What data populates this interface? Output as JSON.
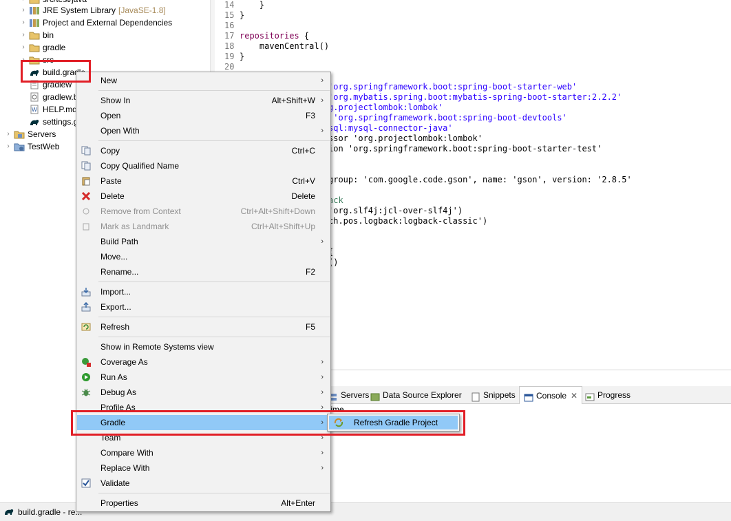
{
  "explorer": {
    "items": [
      {
        "label": "src/test/java",
        "icon": "package-folder-icon",
        "arrow": "›"
      },
      {
        "label": "JRE System Library",
        "decoration": "[JavaSE-1.8]",
        "icon": "library-icon",
        "arrow": "›"
      },
      {
        "label": "Project and External Dependencies",
        "icon": "library-icon",
        "arrow": "›"
      },
      {
        "label": "bin",
        "icon": "folder-icon",
        "arrow": "›"
      },
      {
        "label": "gradle",
        "icon": "folder-icon",
        "arrow": "›"
      },
      {
        "label": "src",
        "icon": "folder-icon",
        "arrow": "›"
      },
      {
        "label": "build.gradle",
        "icon": "gradle-file-icon"
      },
      {
        "label": "gradlew",
        "icon": "text-file-icon"
      },
      {
        "label": "gradlew.bat",
        "icon": "bat-file-icon"
      },
      {
        "label": "HELP.md",
        "icon": "md-file-icon"
      },
      {
        "label": "settings.gradle",
        "icon": "gradle-file-icon"
      },
      {
        "label": "Servers",
        "icon": "servers-folder-icon",
        "arrow": "›"
      },
      {
        "label": "TestWeb",
        "icon": "project-icon",
        "arrow": "›"
      }
    ]
  },
  "editor": {
    "lines": [
      {
        "n": "14",
        "parts": [
          {
            "t": "    }",
            "c": ""
          }
        ]
      },
      {
        "n": "15",
        "parts": [
          {
            "t": "}",
            "c": ""
          }
        ]
      },
      {
        "n": "16",
        "parts": [
          {
            "t": "",
            "c": ""
          }
        ]
      },
      {
        "n": "17",
        "parts": [
          {
            "t": "repositories",
            "c": "kw"
          },
          {
            "t": " {",
            "c": ""
          }
        ]
      },
      {
        "n": "18",
        "parts": [
          {
            "t": "    mavenCentral()",
            "c": ""
          }
        ]
      },
      {
        "n": "19",
        "parts": [
          {
            "t": "}",
            "c": ""
          }
        ]
      },
      {
        "n": "20",
        "parts": [
          {
            "t": "",
            "c": ""
          }
        ]
      }
    ],
    "visible_fragments": [
      {
        "t": "'org.springframework.boot:spring-boot-starter-web'",
        "c": "str"
      },
      {
        "t": "'org.mybatis.spring.boot:mybatis-spring-boot-starter:2.2.2'",
        "c": "str"
      },
      {
        "t": "g.projectlombok:lombok'",
        "c": "str"
      },
      {
        "t": " 'org.springframework.boot:spring-boot-devtools'",
        "c": "str"
      },
      {
        "t": "sql:mysql-connector-java'",
        "c": "str"
      },
      {
        "t": "ssor 'org.projectlombok:lombok'",
        "c": "mixed"
      },
      {
        "t": "ion 'org.springframework.boot:spring-boot-starter-test'",
        "c": "mixed"
      },
      {
        "t": "group: 'com.google.code.gson', name: 'gson', version: '2.8.5'",
        "c": "mixed"
      },
      {
        "t": "ack",
        "c": "cmt"
      },
      {
        "t": "'org.slf4j:jcl-over-slf4j')",
        "c": "mixed"
      },
      {
        "t": "ch.pos.logback:logback-classic')",
        "c": "mixed"
      },
      {
        "t": "{",
        "c": ""
      },
      {
        "t": "()",
        "c": ""
      }
    ]
  },
  "bottom_panel": {
    "tabs": [
      {
        "label": "Servers",
        "icon": "servers-icon"
      },
      {
        "label": "Data Source Explorer",
        "icon": "data-source-icon"
      },
      {
        "label": "Snippets",
        "icon": "snippets-icon"
      },
      {
        "label": "Console",
        "icon": "console-icon",
        "close": "✕"
      },
      {
        "label": "Progress",
        "icon": "progress-icon"
      }
    ],
    "console_text": "time."
  },
  "statusbar": {
    "text": "build.gradle - re..."
  },
  "context_menu": {
    "items": [
      {
        "label": "New",
        "submenu": true
      },
      {
        "label": "Show In",
        "shortcut": "Alt+Shift+W",
        "submenu": true
      },
      {
        "label": "Open",
        "shortcut": "F3"
      },
      {
        "label": "Open With",
        "submenu": true
      },
      {
        "label": "Copy",
        "shortcut": "Ctrl+C",
        "icon": "copy-icon"
      },
      {
        "label": "Copy Qualified Name",
        "icon": "copy-qualified-icon"
      },
      {
        "label": "Paste",
        "shortcut": "Ctrl+V",
        "icon": "paste-icon"
      },
      {
        "label": "Delete",
        "shortcut": "Delete",
        "icon": "delete-icon"
      },
      {
        "label": "Remove from Context",
        "shortcut": "Ctrl+Alt+Shift+Down",
        "icon": "remove-context-icon",
        "disabled": true
      },
      {
        "label": "Mark as Landmark",
        "shortcut": "Ctrl+Alt+Shift+Up",
        "icon": "landmark-icon",
        "disabled": true
      },
      {
        "label": "Build Path",
        "submenu": true
      },
      {
        "label": "Move..."
      },
      {
        "label": "Rename...",
        "shortcut": "F2"
      },
      {
        "label": "Import...",
        "icon": "import-icon"
      },
      {
        "label": "Export...",
        "icon": "export-icon"
      },
      {
        "label": "Refresh",
        "shortcut": "F5",
        "icon": "refresh-icon"
      },
      {
        "label": "Show in Remote Systems view"
      },
      {
        "label": "Coverage As",
        "icon": "coverage-icon",
        "submenu": true
      },
      {
        "label": "Run As",
        "icon": "run-icon",
        "submenu": true
      },
      {
        "label": "Debug As",
        "icon": "debug-icon",
        "submenu": true
      },
      {
        "label": "Profile As",
        "submenu": true
      },
      {
        "label": "Gradle",
        "submenu": true,
        "highlight": true
      },
      {
        "label": "Team",
        "submenu": true
      },
      {
        "label": "Compare With",
        "submenu": true
      },
      {
        "label": "Replace With",
        "submenu": true
      },
      {
        "label": "Validate",
        "icon": "validate-check-icon"
      },
      {
        "label": "Properties",
        "shortcut": "Alt+Enter"
      }
    ],
    "submenu_arrow": "›"
  },
  "gradle_submenu": {
    "items": [
      {
        "label": "Refresh Gradle Project",
        "icon": "gradle-refresh-icon"
      }
    ]
  },
  "colors": {
    "highlight": "#91c9f7",
    "annotation_red": "#e11e26",
    "keyword": "#7f0055",
    "string": "#2a00ff",
    "comment": "#3f7f5f"
  }
}
